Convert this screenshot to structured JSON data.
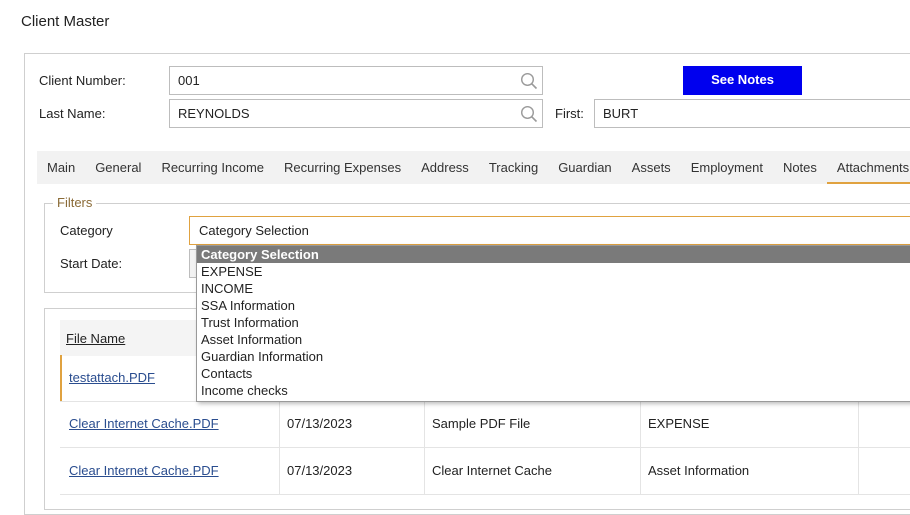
{
  "page_title": "Client Master",
  "client": {
    "number_label": "Client Number:",
    "number_value": "001",
    "last_name_label": "Last Name:",
    "last_name_value": "REYNOLDS",
    "first_label": "First:",
    "first_value": "BURT",
    "see_notes_label": "See Notes"
  },
  "tabs": [
    {
      "label": "Main"
    },
    {
      "label": "General"
    },
    {
      "label": "Recurring Income"
    },
    {
      "label": "Recurring Expenses"
    },
    {
      "label": "Address"
    },
    {
      "label": "Tracking"
    },
    {
      "label": "Guardian"
    },
    {
      "label": "Assets"
    },
    {
      "label": "Employment"
    },
    {
      "label": "Notes"
    },
    {
      "label": "Attachments",
      "active": true
    }
  ],
  "filters": {
    "legend": "Filters",
    "category_label": "Category",
    "category_value": "Category Selection",
    "start_date_label": "Start Date:",
    "options": [
      "Category Selection",
      "EXPENSE",
      "INCOME",
      "SSA Information",
      "Trust Information",
      "Asset Information",
      "Guardian Information",
      "Contacts",
      "Income checks"
    ]
  },
  "table": {
    "header_file_name": "File Name",
    "rows": [
      {
        "file": "testattach.PDF",
        "date": "",
        "desc": "",
        "category": ""
      },
      {
        "file": "Clear Internet Cache.PDF",
        "date": "07/13/2023",
        "desc": "Sample PDF File",
        "category": "EXPENSE"
      },
      {
        "file": "Clear Internet Cache.PDF",
        "date": "07/13/2023",
        "desc": "Clear Internet Cache",
        "category": "Asset Information"
      }
    ]
  },
  "colors": {
    "accent": "#e0a240",
    "button_blue": "#0000ee",
    "link": "#2a4d8f",
    "selected_option": "#7a7a7a"
  }
}
